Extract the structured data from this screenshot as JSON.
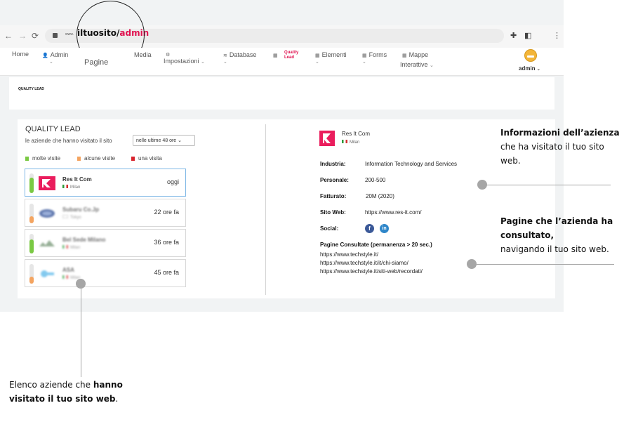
{
  "browser": {
    "url_small": "www.",
    "url_domain": "iltuosito/",
    "url_path": "admin"
  },
  "menu": {
    "home": "Home",
    "admin": "Admin",
    "pagine": "Pagine",
    "media": "Media",
    "impostazioni": "Impostazioni",
    "database": "Database",
    "quality_lead_line1": "Quality",
    "quality_lead_line2": "Lead",
    "elementi": "Elementi",
    "forms": "Forms",
    "mappe": "Mappe",
    "interattive": "Interattive",
    "user": "admin"
  },
  "top_card": {
    "label": "QUALITY LEAD"
  },
  "left_panel": {
    "title": "QUALITY LEAD",
    "subtitle": "le aziende che hanno visitato il sito",
    "period": "nelle ultime 48 ore",
    "legend": [
      {
        "label": "molte visite",
        "color": "#7ac943"
      },
      {
        "label": "alcune visite",
        "color": "#f4a460"
      },
      {
        "label": "una visita",
        "color": "#d9232d"
      }
    ],
    "companies": [
      {
        "name": "Res It Com",
        "city": "Milan",
        "time": "oggi",
        "level": 0.8,
        "color": "#7ac943"
      },
      {
        "name": "Subaru Co.Jp",
        "city": "Tokyo",
        "time": "22 ore fa",
        "level": 0.35,
        "color": "#f4a460"
      },
      {
        "name": "Bel Sede Milano",
        "city": "Milan",
        "time": "36 ore fa",
        "level": 0.7,
        "color": "#7ac943"
      },
      {
        "name": "ASA",
        "city": "Milan",
        "time": "45 ore fa",
        "level": 0.35,
        "color": "#f4a460"
      }
    ]
  },
  "detail": {
    "company_name": "Res It Com",
    "city": "Milan",
    "industria_label": "Industria:",
    "industria_value": "Information Technology and Services",
    "personale_label": "Personale:",
    "personale_value": "200-500",
    "fatturato_label": "Fatturato:",
    "fatturato_value": "20M (2020)",
    "sito_label": "Sito Web:",
    "sito_value": "https://www.res-it.com/",
    "social_label": "Social:",
    "facebook": "f",
    "linkedin": "in",
    "pages_title": "Pagine Consultate (permanenza > 20 sec.)",
    "pages": [
      "https://www.techstyle.it/",
      "https://www.techstyle.it/it/chi-siamo/",
      "https://www.techstyle.it/siti-web/recordati/"
    ]
  },
  "callouts": {
    "info_bold": "Informazioni dell’azienza",
    "info_rest_1": "che ha visitato il tuo sito",
    "info_rest_2": "web.",
    "pages_bold_1": "Pagine che l’azienda ha",
    "pages_bold_2": "consultato,",
    "pages_rest": "navigando il tuo sito web.",
    "list_text_1": "Elenco aziende che ",
    "list_bold_1": "hanno",
    "list_bold_2": "visitato il tuo sito web",
    "list_text_2": "."
  }
}
